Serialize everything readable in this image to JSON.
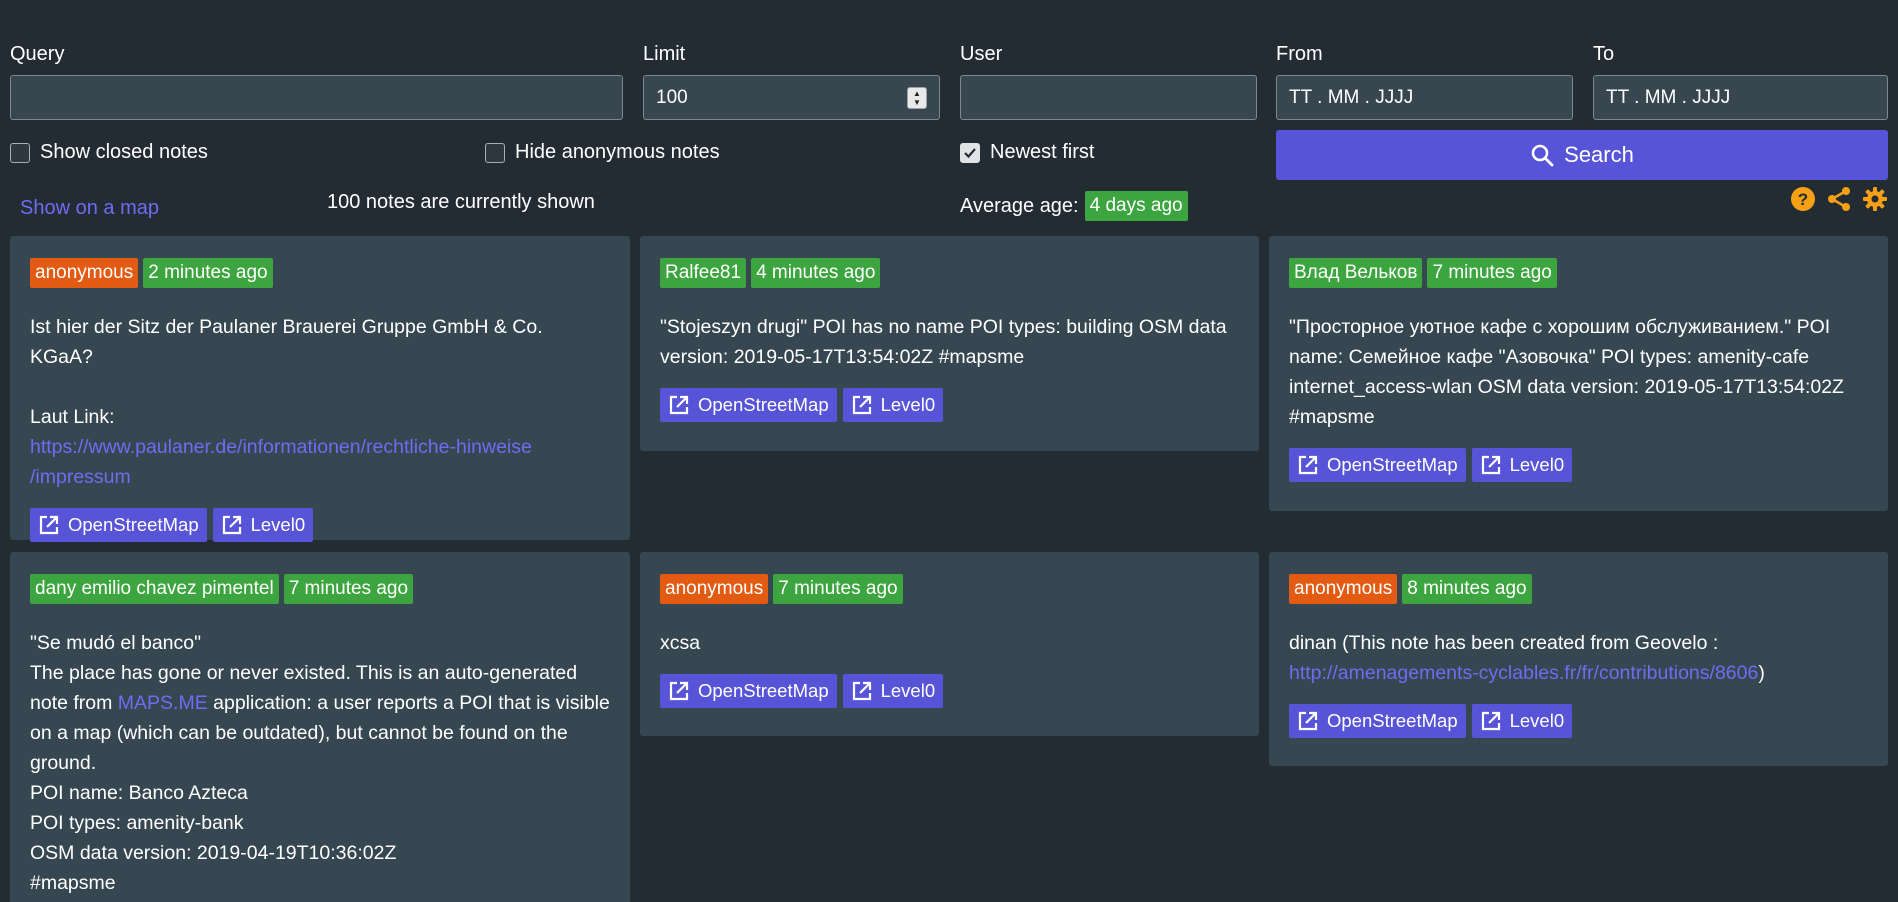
{
  "filters": {
    "query_label": "Query",
    "query_value": "",
    "limit_label": "Limit",
    "limit_value": "100",
    "user_label": "User",
    "user_value": "",
    "from_label": "From",
    "from_placeholder": "TT . MM . JJJJ",
    "to_label": "To",
    "to_placeholder": "TT . MM . JJJJ"
  },
  "options": {
    "show_closed": {
      "label": "Show closed notes",
      "checked": false
    },
    "hide_anonymous": {
      "label": "Hide anonymous notes",
      "checked": false
    },
    "newest_first": {
      "label": "Newest first",
      "checked": true
    }
  },
  "search_button": {
    "label": "Search",
    "icon": "search-icon"
  },
  "status": {
    "show_on_map": "Show on a map",
    "count_text": "100 notes are currently shown",
    "avg_age_label": "Average age:",
    "avg_age_value": "4 days ago"
  },
  "toolbar_icons": [
    "help-icon",
    "share-icon",
    "settings-icon"
  ],
  "colors": {
    "accent": "#5754d8",
    "green": "#3da53f",
    "orange": "#e35b12",
    "link": "#6f6cf2",
    "icon": "#f7a016"
  },
  "notes": [
    {
      "user": "anonymous",
      "user_color": "orange",
      "age": "2 minutes ago",
      "line1": "Ist hier der Sitz der Paulaner Brauerei Gruppe GmbH & Co. KGaA?",
      "line2": "Laut Link:",
      "link": "https://www.paulaner.de/informationen/rechtliche-hinweise/impressum",
      "link_part1": "https://www.paulaner.de/informationen/rechtliche-hinweise",
      "link_part2": "/impressum",
      "osm_label": "OpenStreetMap",
      "level0_label": "Level0"
    },
    {
      "user": "Ralfee81",
      "user_color": "green",
      "age": "4 minutes ago",
      "text": "\"Stojeszyn drugi\" POI has no name POI types: building OSM data version: 2019-05-17T13:54:02Z #mapsme",
      "osm_label": "OpenStreetMap",
      "level0_label": "Level0"
    },
    {
      "user": "Влад Вельков",
      "user_color": "green",
      "age": "7 minutes ago",
      "text": "\"Просторное уютное кафе с хорошим обслуживанием.\" POI name: Семейное кафе \"Азовочка\" POI types: amenity-cafe internet_access-wlan OSM data version: 2019-05-17T13:54:02Z #mapsme",
      "osm_label": "OpenStreetMap",
      "level0_label": "Level0"
    },
    {
      "user": "dany emilio chavez pimentel",
      "user_color": "green",
      "age": "7 minutes ago",
      "line1": "\"Se mudó el banco\"",
      "line2a": "The place has gone or never existed. This is an auto-generated note from ",
      "line2_link": "MAPS.ME",
      "line2b": " application: a user reports a POI that is visi­ble on a map (which can be outdated), but cannot be found on the ground.",
      "line3": "POI name: Banco Azteca",
      "line4": "POI types: amenity-bank",
      "line5": "OSM data version: 2019-04-19T10:36:02Z",
      "line6": "#mapsme"
    },
    {
      "user": "anonymous",
      "user_color": "orange",
      "age": "7 minutes ago",
      "text": "xcsa",
      "osm_label": "OpenStreetMap",
      "level0_label": "Level0"
    },
    {
      "user": "anonymous",
      "user_color": "orange",
      "age": "8 minutes ago",
      "text_before": "dinan (This note has been created from Geovelo :",
      "link": "http://amenagements-cyclables.fr/fr/contributions/8606",
      "text_after": ")",
      "osm_label": "OpenStreetMap",
      "level0_label": "Level0"
    }
  ]
}
